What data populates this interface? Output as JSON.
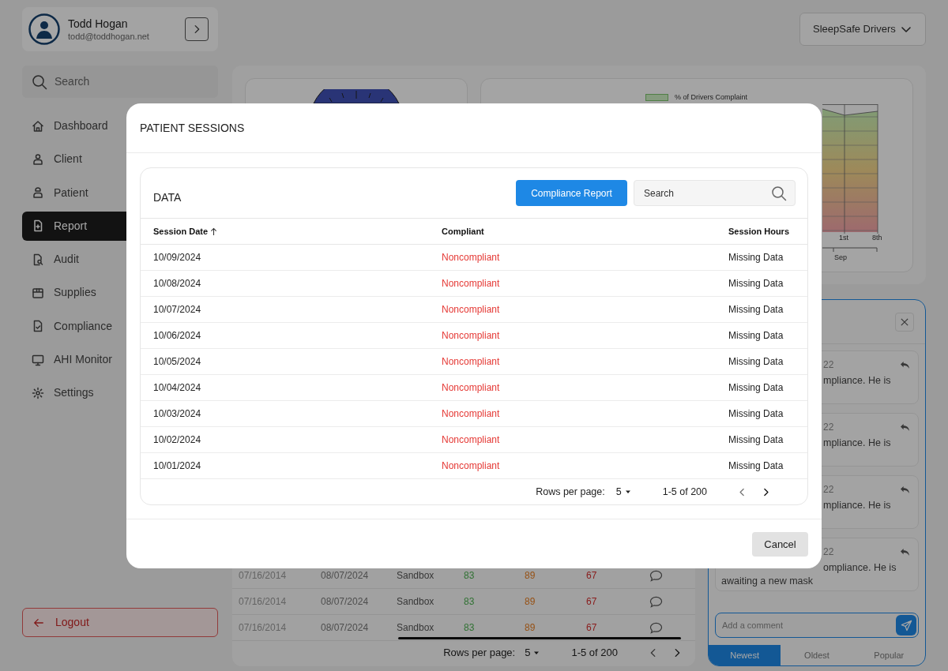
{
  "profile": {
    "name": "Todd Hogan",
    "email": "todd@toddhogan.net"
  },
  "organization_select": {
    "value": "SleepSafe Drivers"
  },
  "sidebar": {
    "search_placeholder": "Search",
    "items": [
      {
        "label": "Dashboard",
        "selected": false
      },
      {
        "label": "Client",
        "selected": false
      },
      {
        "label": "Patient",
        "selected": false
      },
      {
        "label": "Report",
        "selected": true
      },
      {
        "label": "Audit",
        "selected": false
      },
      {
        "label": "Supplies",
        "selected": false
      },
      {
        "label": "Compliance",
        "selected": false
      },
      {
        "label": "AHI Monitor",
        "selected": false
      },
      {
        "label": "Settings",
        "selected": false
      }
    ],
    "logout": "Logout"
  },
  "compliance_chart": {
    "legend": "% of Drivers Complaint",
    "x_ticks": [
      "1st",
      "8th"
    ],
    "x_group": "Sep"
  },
  "background_table": {
    "rows": [
      {
        "cells": [
          "07/16/2014",
          "08/07/2024",
          "Sandbox",
          "83",
          "89",
          "67"
        ]
      },
      {
        "cells": [
          "07/16/2014",
          "08/07/2024",
          "Sandbox",
          "83",
          "89",
          "67"
        ]
      },
      {
        "cells": [
          "07/16/2014",
          "08/07/2024",
          "Sandbox",
          "83",
          "89",
          "67"
        ]
      }
    ],
    "pagination": {
      "rows_per_page_label": "Rows per page:",
      "rows_per_page": "5",
      "range": "1-5 of 200"
    }
  },
  "comments_panel": {
    "comments": [
      {
        "date": "22",
        "lines": [
          "mpliance. He is"
        ]
      },
      {
        "date": "22",
        "lines": [
          "mpliance. He is"
        ]
      },
      {
        "date": "22",
        "lines": [
          "mpliance. He is"
        ]
      },
      {
        "date": "22",
        "lines": [
          "ompliance. He is",
          "awaiting a new mask"
        ]
      }
    ],
    "comment_placeholder": "Add a comment",
    "tabs": [
      {
        "label": "Newest",
        "selected": true
      },
      {
        "label": "Oldest",
        "selected": false
      },
      {
        "label": "Popular",
        "selected": false
      }
    ]
  },
  "modal": {
    "title": "PATIENT SESSIONS",
    "section_title": "DATA",
    "primary_button": "Compliance Report",
    "search_placeholder": "Search",
    "columns": [
      {
        "label": "Session Date",
        "sorted": true
      },
      {
        "label": "Compliant",
        "sorted": false
      },
      {
        "label": "Session Hours",
        "sorted": false
      }
    ],
    "rows": [
      {
        "date": "10/09/2024",
        "compliant": "Noncompliant",
        "hours": "Missing Data"
      },
      {
        "date": "10/08/2024",
        "compliant": "Noncompliant",
        "hours": "Missing Data"
      },
      {
        "date": "10/07/2024",
        "compliant": "Noncompliant",
        "hours": "Missing Data"
      },
      {
        "date": "10/06/2024",
        "compliant": "Noncompliant",
        "hours": "Missing Data"
      },
      {
        "date": "10/05/2024",
        "compliant": "Noncompliant",
        "hours": "Missing Data"
      },
      {
        "date": "10/04/2024",
        "compliant": "Noncompliant",
        "hours": "Missing Data"
      },
      {
        "date": "10/03/2024",
        "compliant": "Noncompliant",
        "hours": "Missing Data"
      },
      {
        "date": "10/02/2024",
        "compliant": "Noncompliant",
        "hours": "Missing Data"
      },
      {
        "date": "10/01/2024",
        "compliant": "Noncompliant",
        "hours": "Missing Data"
      }
    ],
    "pagination": {
      "rows_per_page_label": "Rows per page:",
      "rows_per_page": "5",
      "range": "1-5 of 200"
    },
    "cancel_button": "Cancel"
  }
}
